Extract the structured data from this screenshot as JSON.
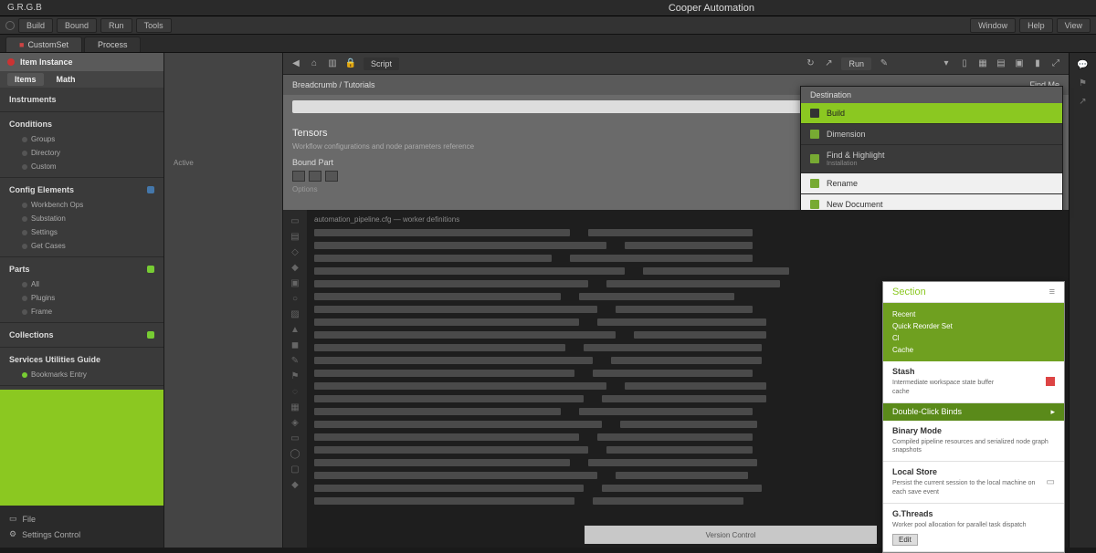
{
  "app": {
    "title": "Cooper Automation",
    "prefix": "G.R.G.B"
  },
  "menubar": [
    "Build",
    "Bound",
    "Run",
    "Tools",
    "Window",
    "Help",
    "View"
  ],
  "tabs": [
    {
      "label": "CustomSet"
    },
    {
      "label": "Process"
    }
  ],
  "sidebar": {
    "title": "Item Instance",
    "tabs": [
      "Items",
      "Math"
    ],
    "sections": [
      {
        "title": "Instruments",
        "items": []
      },
      {
        "title": "Conditions",
        "items": [
          "Groups",
          "Directory",
          "Custom"
        ],
        "badge": "none"
      },
      {
        "title": "Config Elements",
        "badge": "blue",
        "items": [
          "Workbench Ops",
          "Substation",
          "Settings",
          "Get Cases"
        ]
      },
      {
        "title": "Parts",
        "badge": "green",
        "items": [
          "All",
          "Plugins",
          "Frame"
        ]
      },
      {
        "title": "Collections",
        "badge": "green",
        "items": []
      },
      {
        "title": "Services Utilities Guide",
        "badge": "none",
        "items": [
          "Bookmarks Entry"
        ]
      }
    ],
    "footer": [
      {
        "icon": "folder",
        "label": "File"
      },
      {
        "icon": "settings",
        "label": "Settings Control"
      }
    ]
  },
  "midcol": {
    "item": "Active"
  },
  "toolbar": {
    "left_label": "Script",
    "right_label": "Run"
  },
  "inspector": {
    "breadcrumb": "Breadcrumb / Tutorials",
    "header_right": "Find Me",
    "title": "Tensors",
    "subtitle": "Workflow configurations and node parameters reference",
    "group1": "Bound Part",
    "field1": "Options",
    "url_placeholder": ""
  },
  "popup": {
    "header": "Destination",
    "items": [
      {
        "label": "Build",
        "sub": "",
        "state": "active"
      },
      {
        "label": "Dimension",
        "sub": "",
        "state": ""
      },
      {
        "label": "Find & Highlight",
        "sub": "Installation",
        "state": ""
      },
      {
        "label": "Rename",
        "sub": "",
        "state": "white"
      },
      {
        "label": "New Document",
        "sub": "",
        "state": "white"
      }
    ]
  },
  "editor": {
    "header": "automation_pipeline.cfg — worker definitions",
    "line_count": 22
  },
  "rightpanel": {
    "title": "Section",
    "green_lines": [
      "Recent",
      "Quick Reorder Set",
      "Cl",
      "Cache"
    ],
    "sec1_label": "Stash",
    "sec1_text": "Intermediate workspace state buffer",
    "sec1_text2": "cache",
    "strip": "Double-Click Binds",
    "sec2_label": "Binary Mode",
    "sec2_text": "Compiled pipeline resources and serialized node graph snapshots",
    "sec3_label": "Local Store",
    "sec3_text": "Persist the current session to the local machine on each save event",
    "sec4_label": "G.Threads",
    "sec4_text": "Worker pool allocation for parallel task dispatch",
    "btn": "Edit"
  },
  "bottombar": "Version Control"
}
